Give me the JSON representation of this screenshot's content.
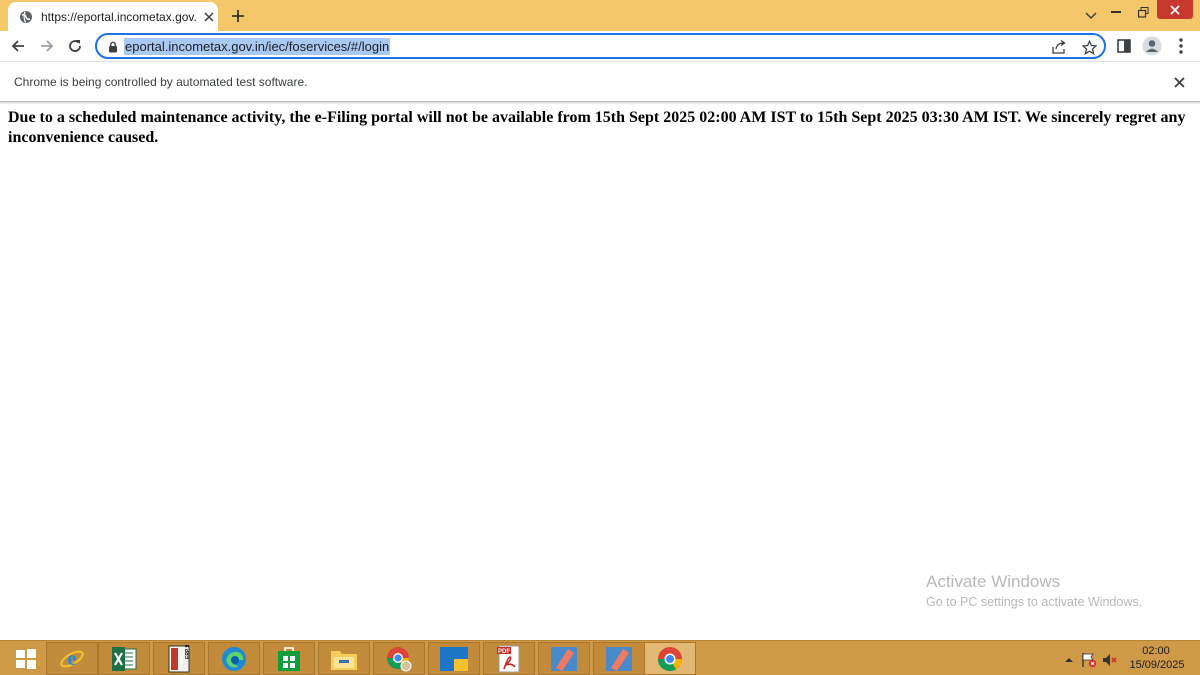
{
  "browser": {
    "tab": {
      "title": "https://eportal.incometax.gov.in/",
      "favicon": "globe-icon",
      "close_icon": "close-icon"
    },
    "new_tab_icon": "plus-icon",
    "window_controls": [
      "tab-list-icon",
      "minimize-icon",
      "restore-icon",
      "close-icon"
    ],
    "toolbar": {
      "url": "eportal.incometax.gov.in/iec/foservices/#/login",
      "buttons": [
        "back-icon",
        "forward-icon",
        "reload-icon"
      ],
      "omnibox_icons": [
        "lock-icon",
        "share-icon",
        "star-icon"
      ],
      "right_icons": [
        "side-panel-icon",
        "profile-icon",
        "kebab-menu-icon"
      ]
    },
    "infobar": {
      "text": "Chrome is being controlled by automated test software."
    },
    "colors": {
      "title_bar": "#f3c76a",
      "focus_ring": "#1a73e8",
      "url_selection": "#a9c9f5",
      "taskbar": "#cf9a48"
    }
  },
  "page": {
    "message": "Due to a scheduled maintenance activity, the e-Filing portal will not be available from 15th Sept 2025 02:00 AM IST to 15th Sept 2025 03:30 AM IST. We sincerely regret any inconvenience caused."
  },
  "watermark": {
    "title": "Activate Windows",
    "subtitle": "Go to PC settings to activate Windows."
  },
  "taskbar": {
    "apps": [
      {
        "name": "start-icon"
      },
      {
        "name": "internet-explorer-icon"
      },
      {
        "name": "excel-icon"
      },
      {
        "name": "tally-erp-icon",
        "label": "Tally ERP 9"
      },
      {
        "name": "edge-icon"
      },
      {
        "name": "store-icon"
      },
      {
        "name": "file-explorer-icon"
      },
      {
        "name": "chrome-profile-icon"
      },
      {
        "name": "folder-app-icon"
      },
      {
        "name": "pdf-icon",
        "label": "PDF"
      },
      {
        "name": "pen-app-icon"
      },
      {
        "name": "pen-app-icon"
      },
      {
        "name": "chrome-icon"
      }
    ],
    "tray": [
      "chevron-up-icon",
      "flag-alert-icon",
      "speaker-muted-icon"
    ],
    "clock": {
      "time": "02:00",
      "date": "15/09/2025"
    }
  }
}
